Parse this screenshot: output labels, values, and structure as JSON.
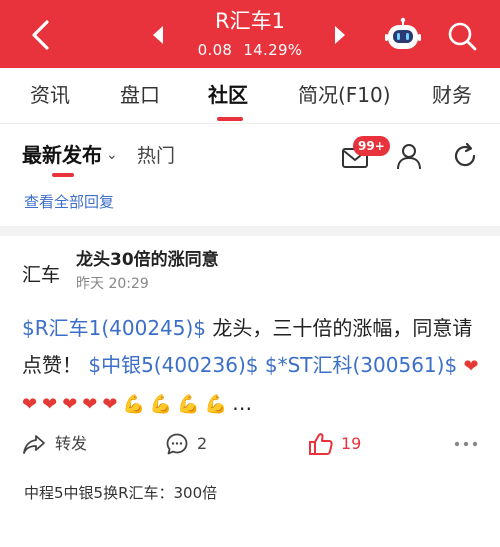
{
  "header": {
    "title": "R汇车1",
    "change": "0.08",
    "change_pct": "14.29%",
    "icons": [
      "back-icon",
      "prev-stock-icon",
      "next-stock-icon",
      "robot-assistant-icon",
      "search-icon"
    ],
    "colors": {
      "bar": "#e8323c",
      "text": "#ffffff"
    }
  },
  "tabs": [
    "资讯",
    "盘口",
    "社区",
    "简况(F10)",
    "财务"
  ],
  "active_tab": "社区",
  "subbar": {
    "latest_label": "最新发布",
    "hot_label": "热门",
    "message_badge": "99+",
    "icons": [
      "message-icon",
      "user-icon",
      "refresh-icon"
    ]
  },
  "reply_link": "查看全部回复",
  "post": {
    "author": "汇车",
    "title": "龙头30倍的涨同意",
    "time": "昨天 20:29",
    "stock1": "$R汇车1(400245)$",
    "text1": " 龙头，三十倍的涨幅，同意请点赞！ ",
    "stock2": "$中银5(400236)$",
    "space": " ",
    "stock3": "$*ST汇科(300561)$",
    "emojis_hearts": [
      "❤",
      "❤",
      "❤",
      "❤",
      "❤",
      "❤"
    ],
    "emojis_arms": [
      "💪",
      "💪",
      "💪",
      "💪",
      "💪"
    ],
    "ellipsis": "…",
    "share_label": "转发",
    "comment_count": "2",
    "like_count": "19",
    "reply_preview": "中程5中银5换R汇车：300倍",
    "colors": {
      "stock_link": "#3c6fc9",
      "like": "#e8323c"
    }
  }
}
